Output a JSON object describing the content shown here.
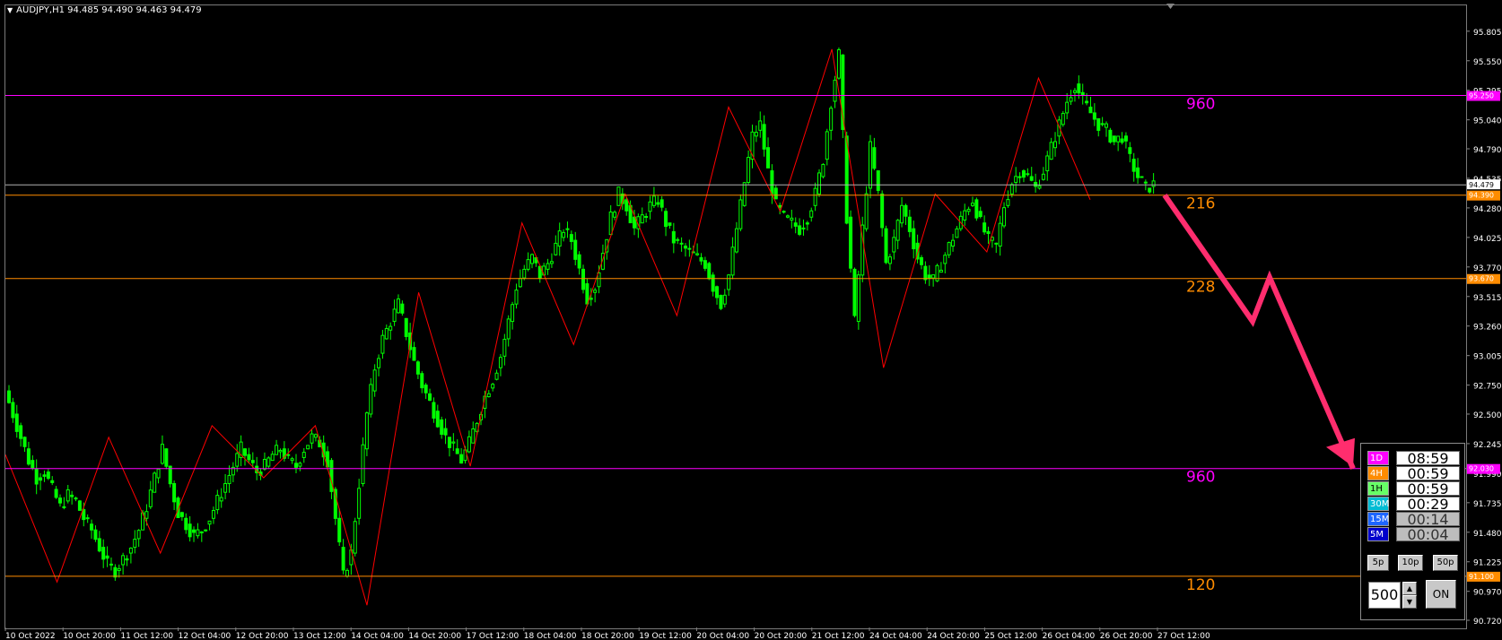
{
  "header": {
    "symbol_line": "AUDJPY,H1  94.485 94.490 94.463 94.479"
  },
  "colors": {
    "background": "#000000",
    "candle": "#00ff00",
    "zigzag": "#ff0000",
    "magenta_level": "#ff00ff",
    "orange_level": "#ff8c00",
    "bid_line": "#b0b0b0",
    "arrow": "#ff2d6e",
    "axis_text": "#ffffff"
  },
  "chart_data": {
    "type": "candlestick",
    "symbol": "AUDJPY",
    "timeframe": "H1",
    "ohlc": {
      "open": 94.485,
      "high": 94.49,
      "low": 94.463,
      "close": 94.479
    },
    "ylim": [
      90.72,
      95.85
    ],
    "y_ticks": [
      "95.805",
      "95.550",
      "95.295",
      "95.040",
      "94.790",
      "94.535",
      "94.280",
      "94.025",
      "93.770",
      "93.515",
      "93.260",
      "93.005",
      "92.750",
      "92.500",
      "92.245",
      "91.990",
      "91.735",
      "91.480",
      "91.225",
      "90.970",
      "90.720"
    ],
    "x_ticks": [
      "10 Oct 2022",
      "10 Oct 20:00",
      "11 Oct 12:00",
      "12 Oct 04:00",
      "12 Oct 20:00",
      "13 Oct 12:00",
      "14 Oct 04:00",
      "14 Oct 20:00",
      "17 Oct 12:00",
      "18 Oct 04:00",
      "18 Oct 20:00",
      "19 Oct 12:00",
      "20 Oct 04:00",
      "20 Oct 20:00",
      "21 Oct 12:00",
      "24 Oct 04:00",
      "24 Oct 20:00",
      "25 Oct 12:00",
      "26 Oct 04:00",
      "26 Oct 20:00",
      "27 Oct 12:00"
    ],
    "bid_price": {
      "value": 94.479,
      "label": "94.479"
    },
    "levels": [
      {
        "value": 95.25,
        "label": "95.250",
        "pips": "960",
        "color": "#ff00ff"
      },
      {
        "value": 94.39,
        "label": "94.390",
        "pips": "216",
        "color": "#ff8c00"
      },
      {
        "value": 93.67,
        "label": "93.670",
        "pips": "228",
        "color": "#ff8c00"
      },
      {
        "value": 92.03,
        "label": "92.030",
        "pips": "960",
        "color": "#ff00ff"
      },
      {
        "value": 91.1,
        "label": "91.100",
        "pips": "120",
        "color": "#ff8c00"
      }
    ],
    "zigzag_prices": [
      92.15,
      91.05,
      92.3,
      91.3,
      92.4,
      91.95,
      92.4,
      90.85,
      93.55,
      92.05,
      94.15,
      93.1,
      94.4,
      93.35,
      95.15,
      94.25,
      95.65,
      92.9,
      94.4,
      93.9,
      95.4,
      94.35
    ],
    "projection_prices": [
      94.39,
      93.3,
      93.68,
      92.03
    ],
    "close_series": [
      92.7,
      92.5,
      92.3,
      92.1,
      91.95,
      92.0,
      91.85,
      91.7,
      91.8,
      91.75,
      91.6,
      91.5,
      91.35,
      91.2,
      91.15,
      91.25,
      91.35,
      91.5,
      91.7,
      91.95,
      92.2,
      91.9,
      91.65,
      91.55,
      91.45,
      91.5,
      91.6,
      91.75,
      91.9,
      92.05,
      92.2,
      92.1,
      92.0,
      92.05,
      92.15,
      92.2,
      92.1,
      92.05,
      92.2,
      92.3,
      92.25,
      92.1,
      91.6,
      91.1,
      91.3,
      91.9,
      92.5,
      92.9,
      93.15,
      93.3,
      93.45,
      93.2,
      92.95,
      92.75,
      92.6,
      92.45,
      92.3,
      92.2,
      92.1,
      92.25,
      92.45,
      92.65,
      92.8,
      93.0,
      93.3,
      93.6,
      93.75,
      93.85,
      93.7,
      93.8,
      93.95,
      94.1,
      94.0,
      93.75,
      93.5,
      93.6,
      93.9,
      94.2,
      94.4,
      94.3,
      94.1,
      94.2,
      94.3,
      94.35,
      94.15,
      94.0,
      93.95,
      93.9,
      93.85,
      93.8,
      93.6,
      93.45,
      93.7,
      94.1,
      94.5,
      94.9,
      95.0,
      94.6,
      94.3,
      94.2,
      94.15,
      94.1,
      94.2,
      94.4,
      94.7,
      95.2,
      95.6,
      94.2,
      93.3,
      94.1,
      94.8,
      94.4,
      93.8,
      94.0,
      94.3,
      94.1,
      93.85,
      93.7,
      93.65,
      93.8,
      93.95,
      94.1,
      94.25,
      94.35,
      94.15,
      94.0,
      93.95,
      94.3,
      94.5,
      94.6,
      94.55,
      94.45,
      94.6,
      94.8,
      95.0,
      95.2,
      95.35,
      95.2,
      95.1,
      95.0,
      94.95,
      94.85,
      94.9,
      94.7,
      94.55,
      94.45,
      94.48
    ]
  },
  "panel": {
    "timers": [
      {
        "tf": "1D",
        "time": "08:59",
        "color": "#ff00ff",
        "text_color": "#ffffff",
        "dim": false
      },
      {
        "tf": "4H",
        "time": "00:59",
        "color": "#ff8c00",
        "text_color": "#ffffff",
        "dim": false
      },
      {
        "tf": "1H",
        "time": "00:59",
        "color": "#66ff66",
        "text_color": "#000000",
        "dim": false
      },
      {
        "tf": "30M",
        "time": "00:29",
        "color": "#00bcd4",
        "text_color": "#ffffff",
        "dim": false
      },
      {
        "tf": "15M",
        "time": "00:14",
        "color": "#1e66ff",
        "text_color": "#ffffff",
        "dim": true
      },
      {
        "tf": "5M",
        "time": "00:04",
        "color": "#0000cc",
        "text_color": "#ffffff",
        "dim": true
      }
    ],
    "step_buttons": [
      "5p",
      "10p",
      "50p"
    ],
    "count_value": "500",
    "toggle_label": "ON"
  }
}
